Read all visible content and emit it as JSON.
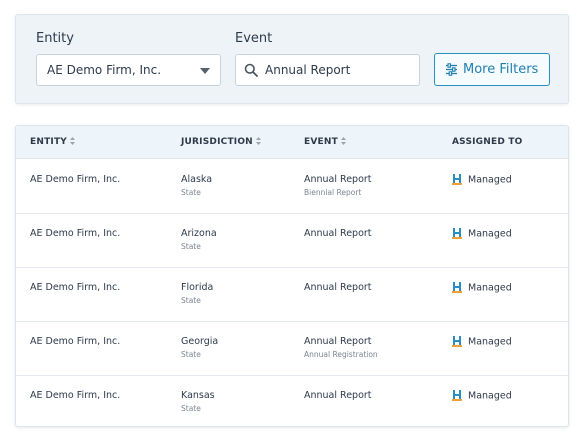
{
  "filters": {
    "entity_label": "Entity",
    "entity_value": "AE Demo Firm, Inc.",
    "event_label": "Event",
    "event_value": "Annual Report",
    "more_filters_label": "More Filters"
  },
  "table": {
    "columns": [
      "ENTITY",
      "JURISDICTION",
      "EVENT",
      "ASSIGNED TO"
    ],
    "rows": [
      {
        "entity": "AE Demo Firm, Inc.",
        "jurisdiction": "Alaska",
        "jurisdiction_sub": "State",
        "event": "Annual Report",
        "event_sub": "Biennial Report",
        "assigned": "Managed"
      },
      {
        "entity": "AE Demo Firm, Inc.",
        "jurisdiction": "Arizona",
        "jurisdiction_sub": "State",
        "event": "Annual Report",
        "event_sub": "",
        "assigned": "Managed"
      },
      {
        "entity": "AE Demo Firm, Inc.",
        "jurisdiction": "Florida",
        "jurisdiction_sub": "State",
        "event": "Annual Report",
        "event_sub": "",
        "assigned": "Managed"
      },
      {
        "entity": "AE Demo Firm, Inc.",
        "jurisdiction": "Georgia",
        "jurisdiction_sub": "State",
        "event": "Annual Report",
        "event_sub": "Annual Registration",
        "assigned": "Managed"
      },
      {
        "entity": "AE Demo Firm, Inc.",
        "jurisdiction": "Kansas",
        "jurisdiction_sub": "State",
        "event": "Annual Report",
        "event_sub": "",
        "assigned": "Managed"
      }
    ]
  },
  "icons": {
    "search": "search-icon",
    "filters": "sliders-icon",
    "sort": "sort-icon",
    "assignee_logo": "h-logo-icon",
    "select_caret": "caret-down-icon"
  },
  "colors": {
    "accent": "#2a8fc0",
    "panel_bg": "#eef3f7",
    "header_bg": "#eef5fa",
    "logo_blue": "#2a8fc0",
    "logo_orange": "#f0a030"
  }
}
